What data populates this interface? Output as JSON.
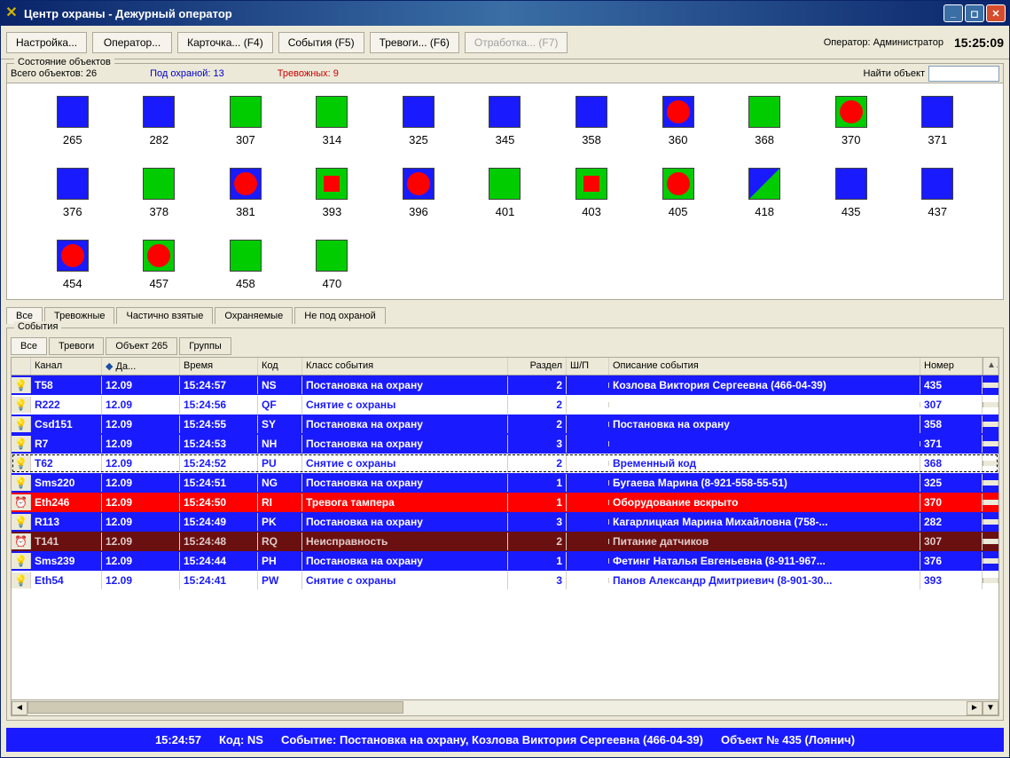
{
  "window": {
    "title": "Центр охраны - Дежурный оператор"
  },
  "toolbar": {
    "buttons": [
      {
        "label": "Настройка...",
        "disabled": false
      },
      {
        "label": "Оператор...",
        "disabled": false
      },
      {
        "label": "Карточка... (F4)",
        "disabled": false
      },
      {
        "label": "События (F5)",
        "disabled": false
      },
      {
        "label": "Тревоги... (F6)",
        "disabled": false
      },
      {
        "label": "Отработка... (F7)",
        "disabled": true
      }
    ],
    "operator_label": "Оператор: Администратор",
    "clock": "15:25:09"
  },
  "objects_box": {
    "legend": "Состояние объектов",
    "total_label": "Всего объектов: 26",
    "armed_label": "Под охраной: 13",
    "alarm_label": "Тревожных: 9",
    "find_label": "Найти объект",
    "find_value": ""
  },
  "objects": [
    {
      "num": "265",
      "bg": "blue",
      "overlay": "none"
    },
    {
      "num": "282",
      "bg": "blue",
      "overlay": "none"
    },
    {
      "num": "307",
      "bg": "green",
      "overlay": "none"
    },
    {
      "num": "314",
      "bg": "green",
      "overlay": "none"
    },
    {
      "num": "325",
      "bg": "blue",
      "overlay": "none"
    },
    {
      "num": "345",
      "bg": "blue",
      "overlay": "none"
    },
    {
      "num": "358",
      "bg": "blue",
      "overlay": "none"
    },
    {
      "num": "360",
      "bg": "blue",
      "overlay": "circle-red"
    },
    {
      "num": "368",
      "bg": "green",
      "overlay": "none"
    },
    {
      "num": "370",
      "bg": "green",
      "overlay": "circle-red"
    },
    {
      "num": "371",
      "bg": "blue",
      "overlay": "none"
    },
    {
      "num": "376",
      "bg": "blue",
      "overlay": "none"
    },
    {
      "num": "378",
      "bg": "green",
      "overlay": "none"
    },
    {
      "num": "381",
      "bg": "blue",
      "overlay": "circle-red"
    },
    {
      "num": "393",
      "bg": "green",
      "overlay": "square-red"
    },
    {
      "num": "396",
      "bg": "blue",
      "overlay": "circle-red"
    },
    {
      "num": "401",
      "bg": "green",
      "overlay": "none"
    },
    {
      "num": "403",
      "bg": "green",
      "overlay": "square-red"
    },
    {
      "num": "405",
      "bg": "green",
      "overlay": "circle-red"
    },
    {
      "num": "418",
      "bg": "blue",
      "overlay": "triangle-green"
    },
    {
      "num": "435",
      "bg": "blue",
      "overlay": "none"
    },
    {
      "num": "437",
      "bg": "blue",
      "overlay": "none"
    },
    {
      "num": "454",
      "bg": "blue",
      "overlay": "circle-red"
    },
    {
      "num": "457",
      "bg": "green",
      "overlay": "circle-red"
    },
    {
      "num": "458",
      "bg": "green",
      "overlay": "none"
    },
    {
      "num": "470",
      "bg": "green",
      "overlay": "none"
    }
  ],
  "obj_tabs": [
    "Все",
    "Тревожные",
    "Частично взятые",
    "Охраняемые",
    "Не под охраной"
  ],
  "obj_tab_active": 0,
  "events_box": {
    "legend": "События"
  },
  "event_tabs": [
    "Все",
    "Тревоги",
    "Объект 265",
    "Группы"
  ],
  "event_tab_active": 0,
  "columns": {
    "channel": "Канал",
    "date": "Да...",
    "time": "Время",
    "code": "Код",
    "class": "Класс события",
    "section": "Раздел",
    "shp": "Ш/П",
    "desc": "Описание события",
    "num": "Номер"
  },
  "events": [
    {
      "icon": "bulb-y",
      "style": "blue",
      "channel": "T58",
      "date": "12.09",
      "time": "15:24:57",
      "code": "NS",
      "klass": "Постановка на охрану",
      "section": "2",
      "shp": "",
      "desc": "Козлова Виктория Сергеевна (466-04-39)",
      "num": "435",
      "selected": false
    },
    {
      "icon": "bulb-off",
      "style": "white",
      "channel": "R222",
      "date": "12.09",
      "time": "15:24:56",
      "code": "QF",
      "klass": "Снятие с охраны",
      "section": "2",
      "shp": "",
      "desc": "",
      "num": "307",
      "selected": false
    },
    {
      "icon": "bulb-y",
      "style": "blue",
      "channel": "Csd151",
      "date": "12.09",
      "time": "15:24:55",
      "code": "SY",
      "klass": "Постановка на охрану",
      "section": "2",
      "shp": "",
      "desc": "Постановка на охрану",
      "num": "358",
      "selected": false
    },
    {
      "icon": "bulb-y",
      "style": "blue",
      "channel": "R7",
      "date": "12.09",
      "time": "15:24:53",
      "code": "NH",
      "klass": "Постановка на охрану",
      "section": "3",
      "shp": "",
      "desc": "",
      "num": "371",
      "selected": false
    },
    {
      "icon": "bulb-off",
      "style": "white",
      "channel": "T62",
      "date": "12.09",
      "time": "15:24:52",
      "code": "PU",
      "klass": "Снятие с охраны",
      "section": "2",
      "shp": "",
      "desc": "Временный код",
      "num": "368",
      "selected": true
    },
    {
      "icon": "bulb-y",
      "style": "blue",
      "channel": "Sms220",
      "date": "12.09",
      "time": "15:24:51",
      "code": "NG",
      "klass": "Постановка на охрану",
      "section": "1",
      "shp": "",
      "desc": "Бугаева Марина  (8-921-558-55-51)",
      "num": "325",
      "selected": false
    },
    {
      "icon": "alarm",
      "style": "red",
      "channel": "Eth246",
      "date": "12.09",
      "time": "15:24:50",
      "code": "RI",
      "klass": "Тревога тампера",
      "section": "1",
      "shp": "",
      "desc": "Оборудование вскрыто",
      "num": "370",
      "selected": false
    },
    {
      "icon": "bulb-y",
      "style": "blue",
      "channel": "R113",
      "date": "12.09",
      "time": "15:24:49",
      "code": "PK",
      "klass": "Постановка на охрану",
      "section": "3",
      "shp": "",
      "desc": "Кагарлицкая Марина Михайловна (758-...",
      "num": "282",
      "selected": false
    },
    {
      "icon": "alarm",
      "style": "maroon",
      "channel": "T141",
      "date": "12.09",
      "time": "15:24:48",
      "code": "RQ",
      "klass": "Неисправность",
      "section": "2",
      "shp": "",
      "desc": "Питание датчиков",
      "num": "307",
      "selected": false
    },
    {
      "icon": "bulb-y",
      "style": "blue",
      "channel": "Sms239",
      "date": "12.09",
      "time": "15:24:44",
      "code": "PH",
      "klass": "Постановка на охрану",
      "section": "1",
      "shp": "",
      "desc": "Фетинг Наталья Евгеньевна (8-911-967...",
      "num": "376",
      "selected": false
    },
    {
      "icon": "bulb-off",
      "style": "white",
      "channel": "Eth54",
      "date": "12.09",
      "time": "15:24:41",
      "code": "PW",
      "klass": "Снятие с охраны",
      "section": "3",
      "shp": "",
      "desc": "Панов Александр Дмитриевич (8-901-30...",
      "num": "393",
      "selected": false
    }
  ],
  "footer": {
    "time": "15:24:57",
    "code": "Код: NS",
    "event": "Событие: Постановка на охрану, Козлова Виктория Сергеевна (466-04-39)",
    "obj": "Объект № 435 (Лоянич)"
  }
}
